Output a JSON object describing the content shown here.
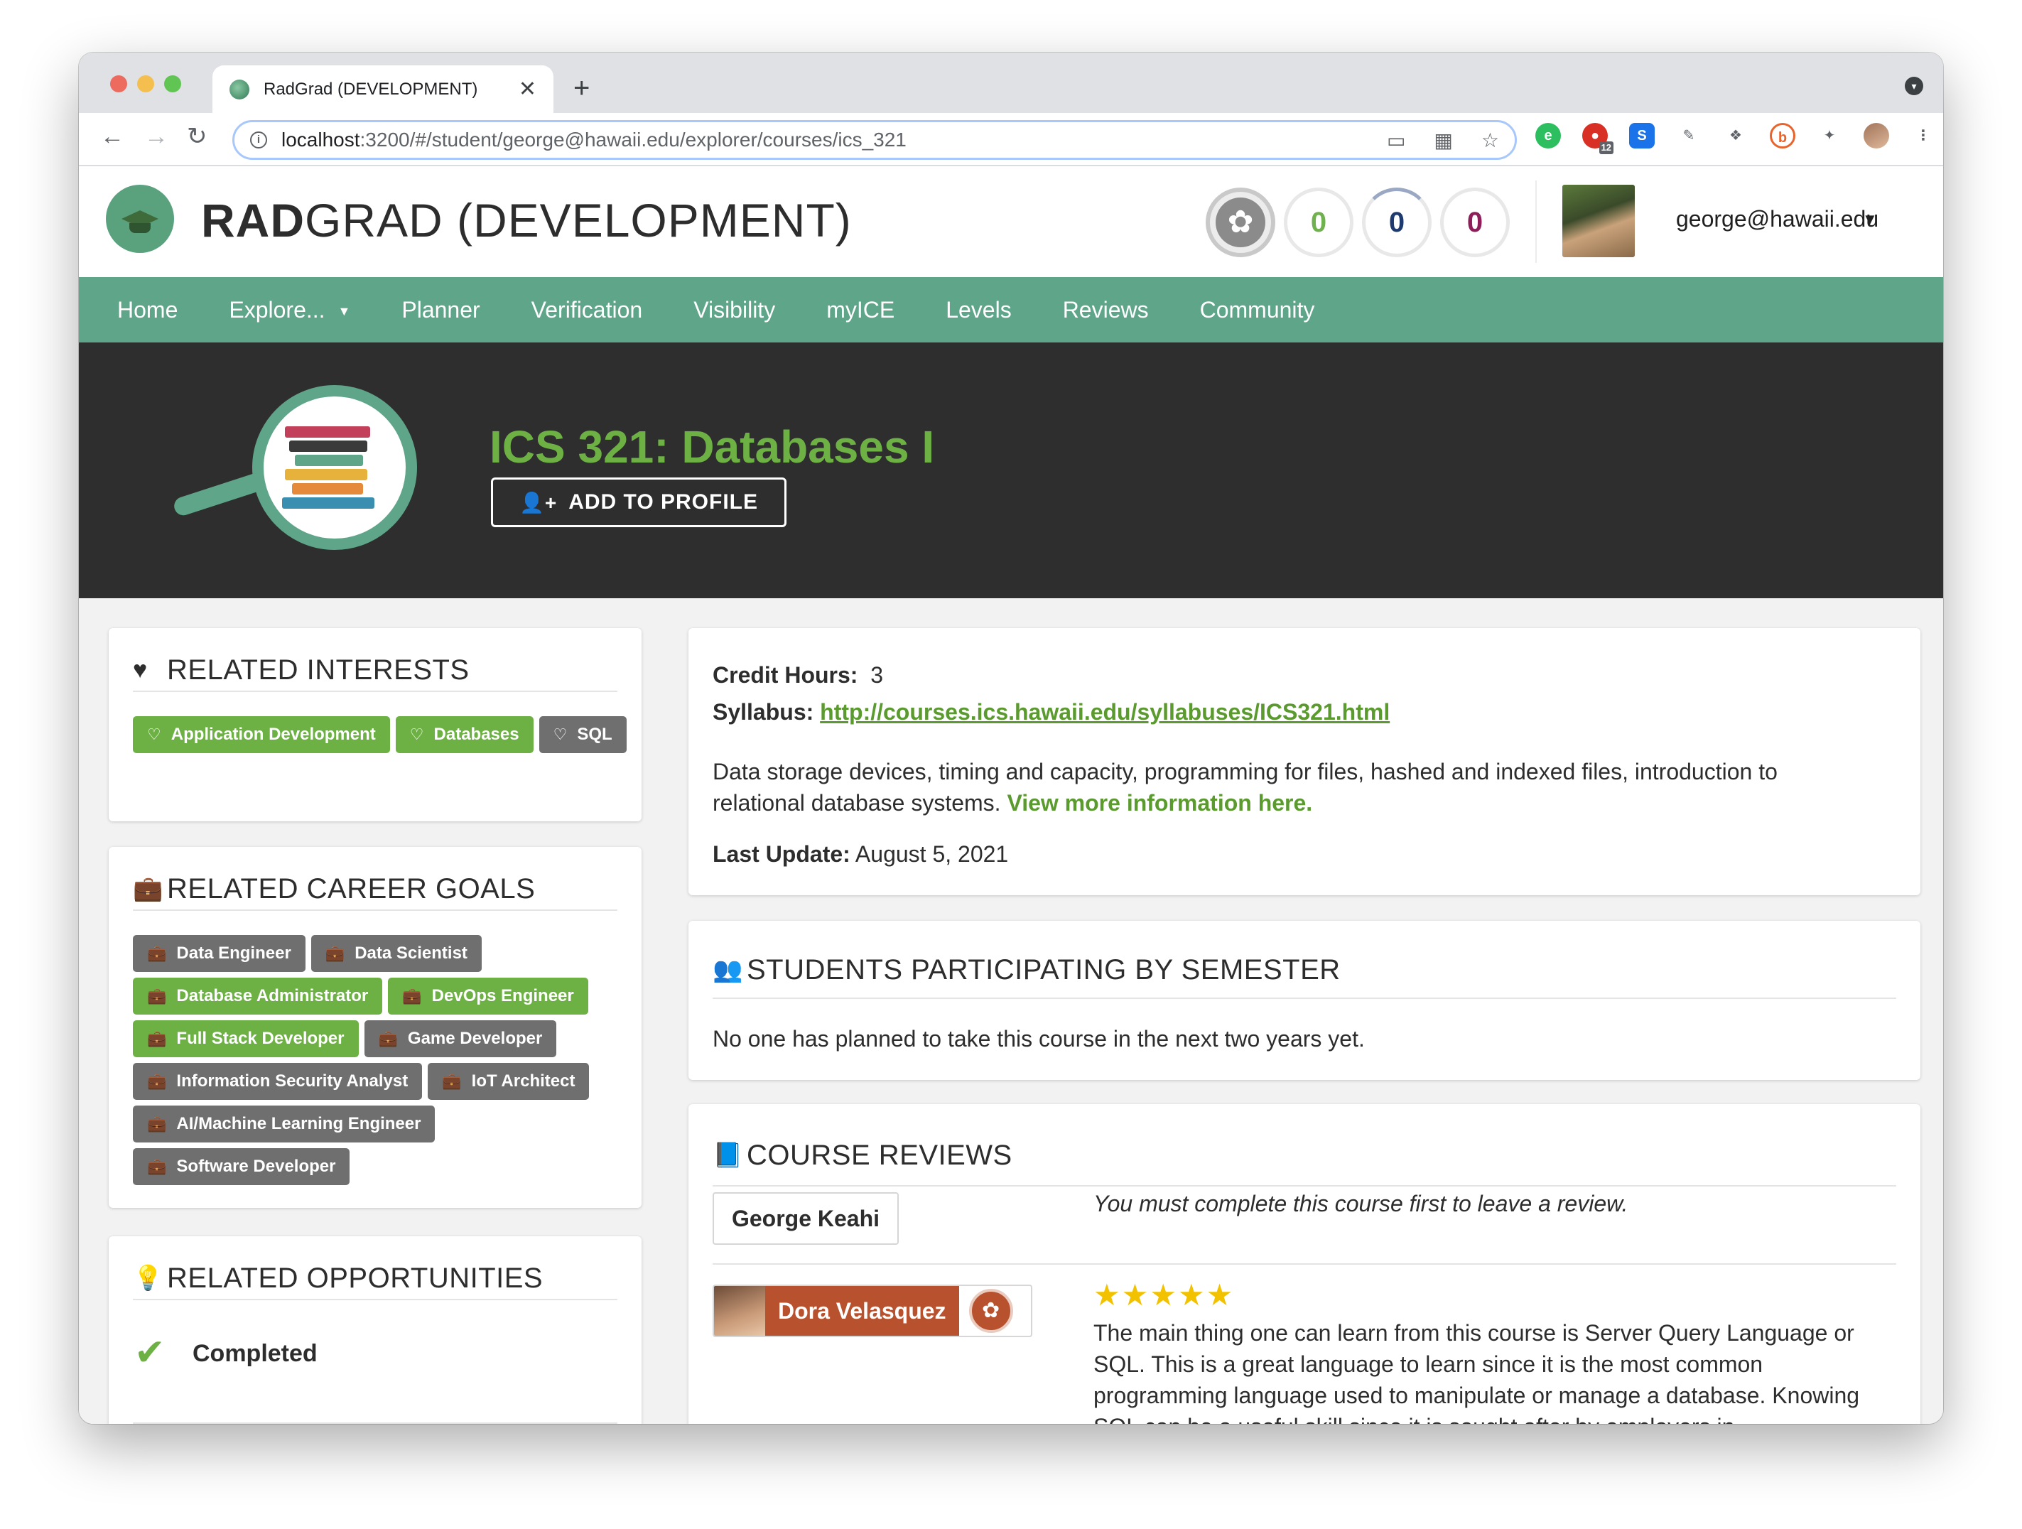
{
  "browser": {
    "tab_title": "RadGrad (DEVELOPMENT)",
    "tab_close": "✕",
    "new_tab": "+",
    "url_host": "localhost",
    "url_rest": ":3200/#/student/george@hawaii.edu/explorer/courses/ics_321",
    "ext_badge": "12"
  },
  "header": {
    "title_bold": "RAD",
    "title_rest": "GRAD (DEVELOPMENT)",
    "ice": {
      "innovation": "0",
      "competency": "0",
      "experience": "0"
    },
    "user_email": "george@hawaii.edu"
  },
  "menu": {
    "items": [
      "Home",
      "Explore...",
      "Planner",
      "Verification",
      "Visibility",
      "myICE",
      "Levels",
      "Reviews",
      "Community"
    ]
  },
  "hero": {
    "course_title": "ICS 321: Databases I",
    "add_button": "ADD TO PROFILE"
  },
  "interests": {
    "title": "RELATED INTERESTS",
    "chips": [
      {
        "label": "Application Development",
        "color": "#6db145"
      },
      {
        "label": "Databases",
        "color": "#6db145"
      },
      {
        "label": "SQL",
        "color": "#6f6f6f"
      }
    ]
  },
  "careers": {
    "title": "RELATED CAREER GOALS",
    "chips": [
      {
        "label": "Data Engineer",
        "color": "#6f6f6f"
      },
      {
        "label": "Data Scientist",
        "color": "#6f6f6f"
      },
      {
        "label": "Database Administrator",
        "color": "#6db145"
      },
      {
        "label": "DevOps Engineer",
        "color": "#6db145"
      },
      {
        "label": "Full Stack Developer",
        "color": "#6db145"
      },
      {
        "label": "Game Developer",
        "color": "#6f6f6f"
      },
      {
        "label": "Information Security Analyst",
        "color": "#6f6f6f"
      },
      {
        "label": "IoT Architect",
        "color": "#6f6f6f"
      },
      {
        "label": "AI/Machine Learning Engineer",
        "color": "#6f6f6f"
      },
      {
        "label": "Software Developer",
        "color": "#6f6f6f"
      }
    ]
  },
  "opportunities": {
    "title": "RELATED OPPORTUNITIES",
    "completed_label": "Completed"
  },
  "details": {
    "credit_label": "Credit Hours:",
    "credit_value": "3",
    "syllabus_label": "Syllabus:",
    "syllabus_url": "http://courses.ics.hawaii.edu/syllabuses/ICS321.html",
    "description": "Data storage devices, timing and capacity, programming for files, hashed and indexed files, introduction to relational database systems.",
    "more_link": "View more information here.",
    "update_label": "Last Update:",
    "update_value": "August 5, 2021"
  },
  "participation": {
    "title": "STUDENTS PARTICIPATING BY SEMESTER",
    "message": "No one has planned to take this course in the next two years yet."
  },
  "reviews": {
    "title": "COURSE REVIEWS",
    "current_user": "George Keahi",
    "note": "You must complete this course first to leave a review.",
    "items": [
      {
        "reviewer": "Dora Velasquez",
        "rating": 5,
        "text": "The main thing one can learn from this course is Server Query Language or SQL. This is a great language to learn since it is the most common programming language used to manipulate or manage a database. Knowing SQL can be a useful skill since it is sought after by employers in"
      }
    ]
  }
}
